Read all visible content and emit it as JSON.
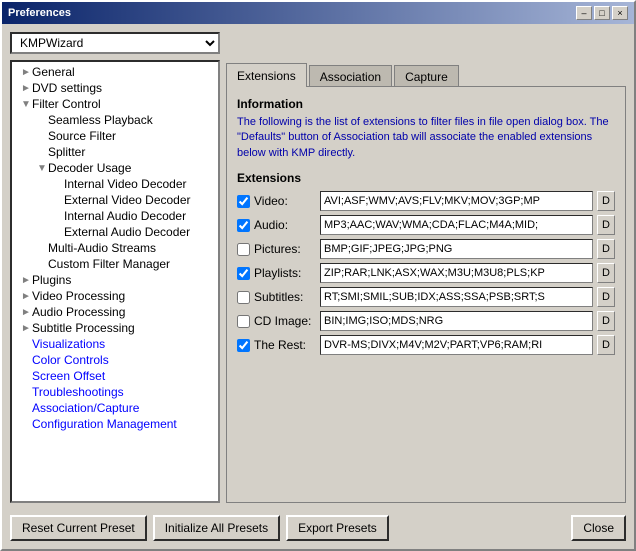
{
  "window": {
    "title": "Preferences",
    "close_btn": "×",
    "min_btn": "–",
    "max_btn": "□"
  },
  "preset_select": {
    "value": "KMPWizard",
    "options": [
      "KMPWizard"
    ]
  },
  "sidebar": {
    "items": [
      {
        "id": "general",
        "label": "General",
        "indent": 1,
        "expand": "►",
        "selected": false
      },
      {
        "id": "dvd-settings",
        "label": "DVD settings",
        "indent": 1,
        "expand": "►",
        "selected": false
      },
      {
        "id": "filter-control",
        "label": "Filter Control",
        "indent": 1,
        "expand": "▼",
        "selected": false
      },
      {
        "id": "seamless-playback",
        "label": "Seamless Playback",
        "indent": 3,
        "expand": "",
        "selected": false
      },
      {
        "id": "source-filter",
        "label": "Source Filter",
        "indent": 3,
        "expand": "",
        "selected": false
      },
      {
        "id": "splitter",
        "label": "Splitter",
        "indent": 3,
        "expand": "",
        "selected": false
      },
      {
        "id": "decoder-usage",
        "label": "Decoder Usage",
        "indent": 3,
        "expand": "▼",
        "selected": false
      },
      {
        "id": "internal-video-decoder",
        "label": "Internal Video Decoder",
        "indent": 5,
        "expand": "",
        "selected": false
      },
      {
        "id": "external-video-decoder",
        "label": "External Video Decoder",
        "indent": 5,
        "expand": "",
        "selected": false
      },
      {
        "id": "internal-audio-decoder",
        "label": "Internal Audio Decoder",
        "indent": 5,
        "expand": "",
        "selected": false
      },
      {
        "id": "external-audio-decoder",
        "label": "External Audio Decoder",
        "indent": 5,
        "expand": "",
        "selected": false
      },
      {
        "id": "multi-audio-streams",
        "label": "Multi-Audio Streams",
        "indent": 3,
        "expand": "",
        "selected": false
      },
      {
        "id": "custom-filter-manager",
        "label": "Custom Filter Manager",
        "indent": 3,
        "expand": "",
        "selected": false
      },
      {
        "id": "plugins",
        "label": "Plugins",
        "indent": 1,
        "expand": "►",
        "selected": false
      },
      {
        "id": "video-processing",
        "label": "Video Processing",
        "indent": 1,
        "expand": "►",
        "selected": false
      },
      {
        "id": "audio-processing",
        "label": "Audio Processing",
        "indent": 1,
        "expand": "►",
        "selected": false
      },
      {
        "id": "subtitle-processing",
        "label": "Subtitle Processing",
        "indent": 1,
        "expand": "►",
        "selected": false
      },
      {
        "id": "visualizations",
        "label": "Visualizations",
        "indent": 1,
        "expand": "",
        "selected": false,
        "blue": true
      },
      {
        "id": "color-controls",
        "label": "Color Controls",
        "indent": 1,
        "expand": "",
        "selected": false,
        "blue": true
      },
      {
        "id": "screen-offset",
        "label": "Screen Offset",
        "indent": 1,
        "expand": "",
        "selected": false,
        "blue": true
      },
      {
        "id": "troubleshootings",
        "label": "Troubleshootings",
        "indent": 1,
        "expand": "",
        "selected": false,
        "blue": true
      },
      {
        "id": "association-capture",
        "label": "Association/Capture",
        "indent": 1,
        "expand": "",
        "selected": false,
        "blue": true
      },
      {
        "id": "configuration-management",
        "label": "Configuration Management",
        "indent": 1,
        "expand": "",
        "selected": false,
        "blue": true
      }
    ]
  },
  "tabs": [
    {
      "id": "extensions",
      "label": "Extensions",
      "active": true
    },
    {
      "id": "association",
      "label": "Association",
      "active": false
    },
    {
      "id": "capture",
      "label": "Capture",
      "active": false
    }
  ],
  "info_section": {
    "title": "Information",
    "text": "The following is the list of extensions to filter files in file open dialog box. The \"Defaults\" button of Association tab will associate the enabled extensions below with KMP directly."
  },
  "extensions_section": {
    "title": "Extensions",
    "rows": [
      {
        "id": "video",
        "label": "Video:",
        "checked": true,
        "value": "AVI;ASF;WMV;AVS;FLV;MKV;MOV;3GP;MP"
      },
      {
        "id": "audio",
        "label": "Audio:",
        "checked": true,
        "value": "MP3;AAC;WAV;WMA;CDA;FLAC;M4A;MID;"
      },
      {
        "id": "pictures",
        "label": "Pictures:",
        "checked": false,
        "value": "BMP;GIF;JPEG;JPG;PNG"
      },
      {
        "id": "playlists",
        "label": "Playlists:",
        "checked": true,
        "value": "ZIP;RAR;LNK;ASX;WAX;M3U;M3U8;PLS;KP"
      },
      {
        "id": "subtitles",
        "label": "Subtitles:",
        "checked": false,
        "value": "RT;SMI;SMIL;SUB;IDX;ASS;SSA;PSB;SRT;S"
      },
      {
        "id": "cd-image",
        "label": "CD Image:",
        "checked": false,
        "value": "BIN;IMG;ISO;MDS;NRG"
      },
      {
        "id": "the-rest",
        "label": "The Rest:",
        "checked": true,
        "value": "DVR-MS;DIVX;M4V;M2V;PART;VP6;RAM;RI"
      }
    ],
    "d_btn_label": "D"
  },
  "bottom_buttons": {
    "reset_label": "Reset Current Preset",
    "initialize_label": "Initialize All Presets",
    "export_label": "Export Presets",
    "close_label": "Close"
  }
}
